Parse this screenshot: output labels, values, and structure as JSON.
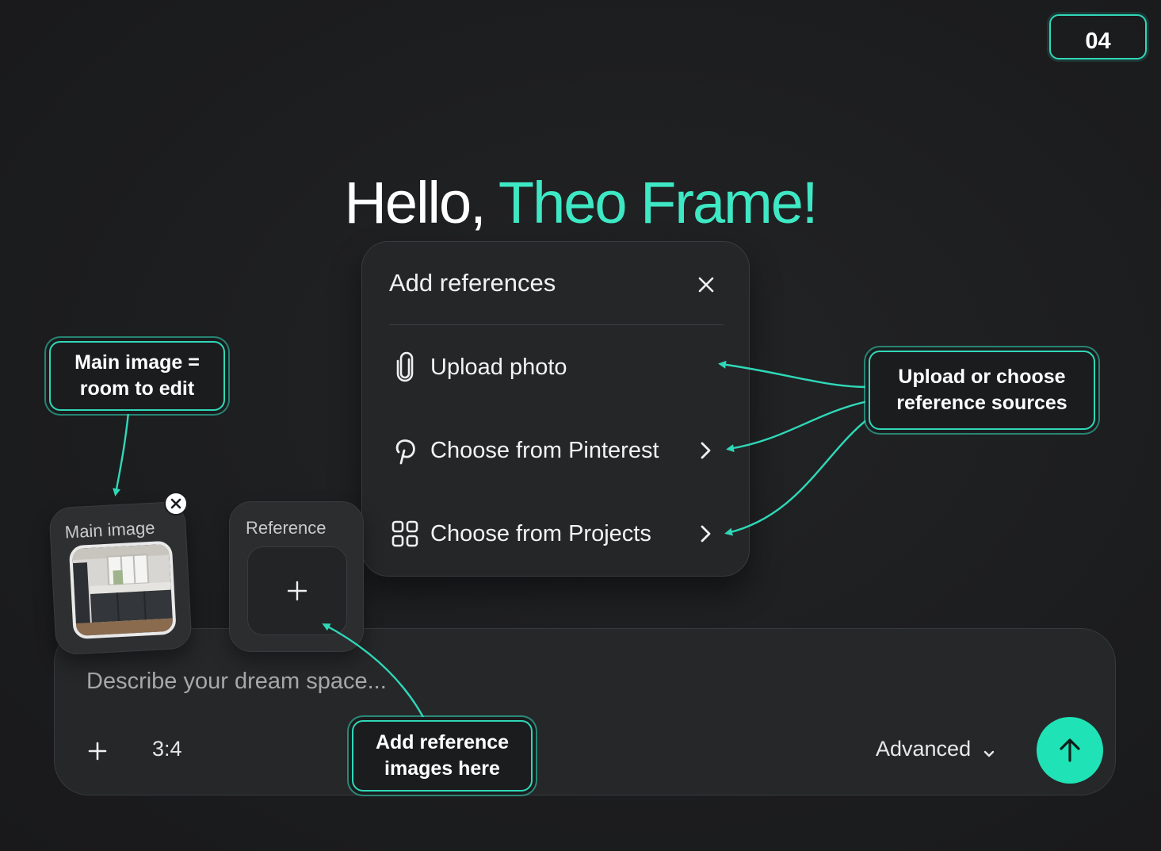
{
  "slide_number": "04",
  "greeting": {
    "hello": "Hello, ",
    "name": "Theo Frame!"
  },
  "popup": {
    "title": "Add references",
    "items": [
      {
        "label": "Upload photo",
        "icon": "paperclip-icon",
        "has_chevron": false
      },
      {
        "label": "Choose from Pinterest",
        "icon": "pinterest-icon",
        "has_chevron": true
      },
      {
        "label": "Choose from Projects",
        "icon": "grid-icon",
        "has_chevron": true
      }
    ]
  },
  "main_image": {
    "label": "Main image"
  },
  "reference": {
    "label": "Reference"
  },
  "prompt": {
    "placeholder": "Describe your dream space...",
    "aspect_ratio": "3:4",
    "advanced_label": "Advanced"
  },
  "annotations": {
    "main_image": "Main image =\nroom to edit",
    "sources": "Upload or choose\nreference sources",
    "reference": "Add reference\nimages here"
  },
  "colors": {
    "accent": "#1fe3b6",
    "annotation": "#2fd8b8",
    "background": "#1c1d1f"
  }
}
